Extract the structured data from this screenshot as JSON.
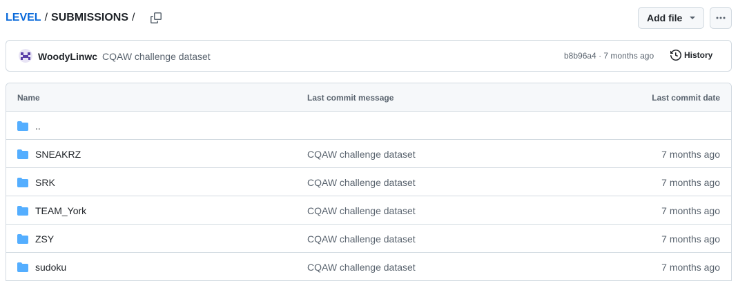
{
  "breadcrumb": {
    "root": "LEVEL",
    "separator": "/",
    "current": "SUBMISSIONS",
    "trailing_separator": "/"
  },
  "toolbar": {
    "add_file_label": "Add file"
  },
  "latest_commit": {
    "author": "WoodyLinwc",
    "message": "CQAW challenge dataset",
    "hash": "b8b96a4",
    "meta_separator": "·",
    "age": "7 months ago",
    "history_label": "History"
  },
  "table": {
    "headers": {
      "name": "Name",
      "message": "Last commit message",
      "date": "Last commit date"
    },
    "parent_dir": "..",
    "rows": [
      {
        "name": "SNEAKRZ",
        "message": "CQAW challenge dataset",
        "date": "7 months ago"
      },
      {
        "name": "SRK",
        "message": "CQAW challenge dataset",
        "date": "7 months ago"
      },
      {
        "name": "TEAM_York",
        "message": "CQAW challenge dataset",
        "date": "7 months ago"
      },
      {
        "name": "ZSY",
        "message": "CQAW challenge dataset",
        "date": "7 months ago"
      },
      {
        "name": "sudoku",
        "message": "CQAW challenge dataset",
        "date": "7 months ago"
      }
    ]
  },
  "colors": {
    "link": "#0969da",
    "folder": "#54aeff",
    "muted": "#59636e",
    "border": "#d1d9e0"
  },
  "icons": {
    "copy": "copy-icon",
    "folder": "folder-icon",
    "history": "history-icon",
    "more": "kebab-horizontal-icon",
    "caret": "triangle-down-icon"
  }
}
